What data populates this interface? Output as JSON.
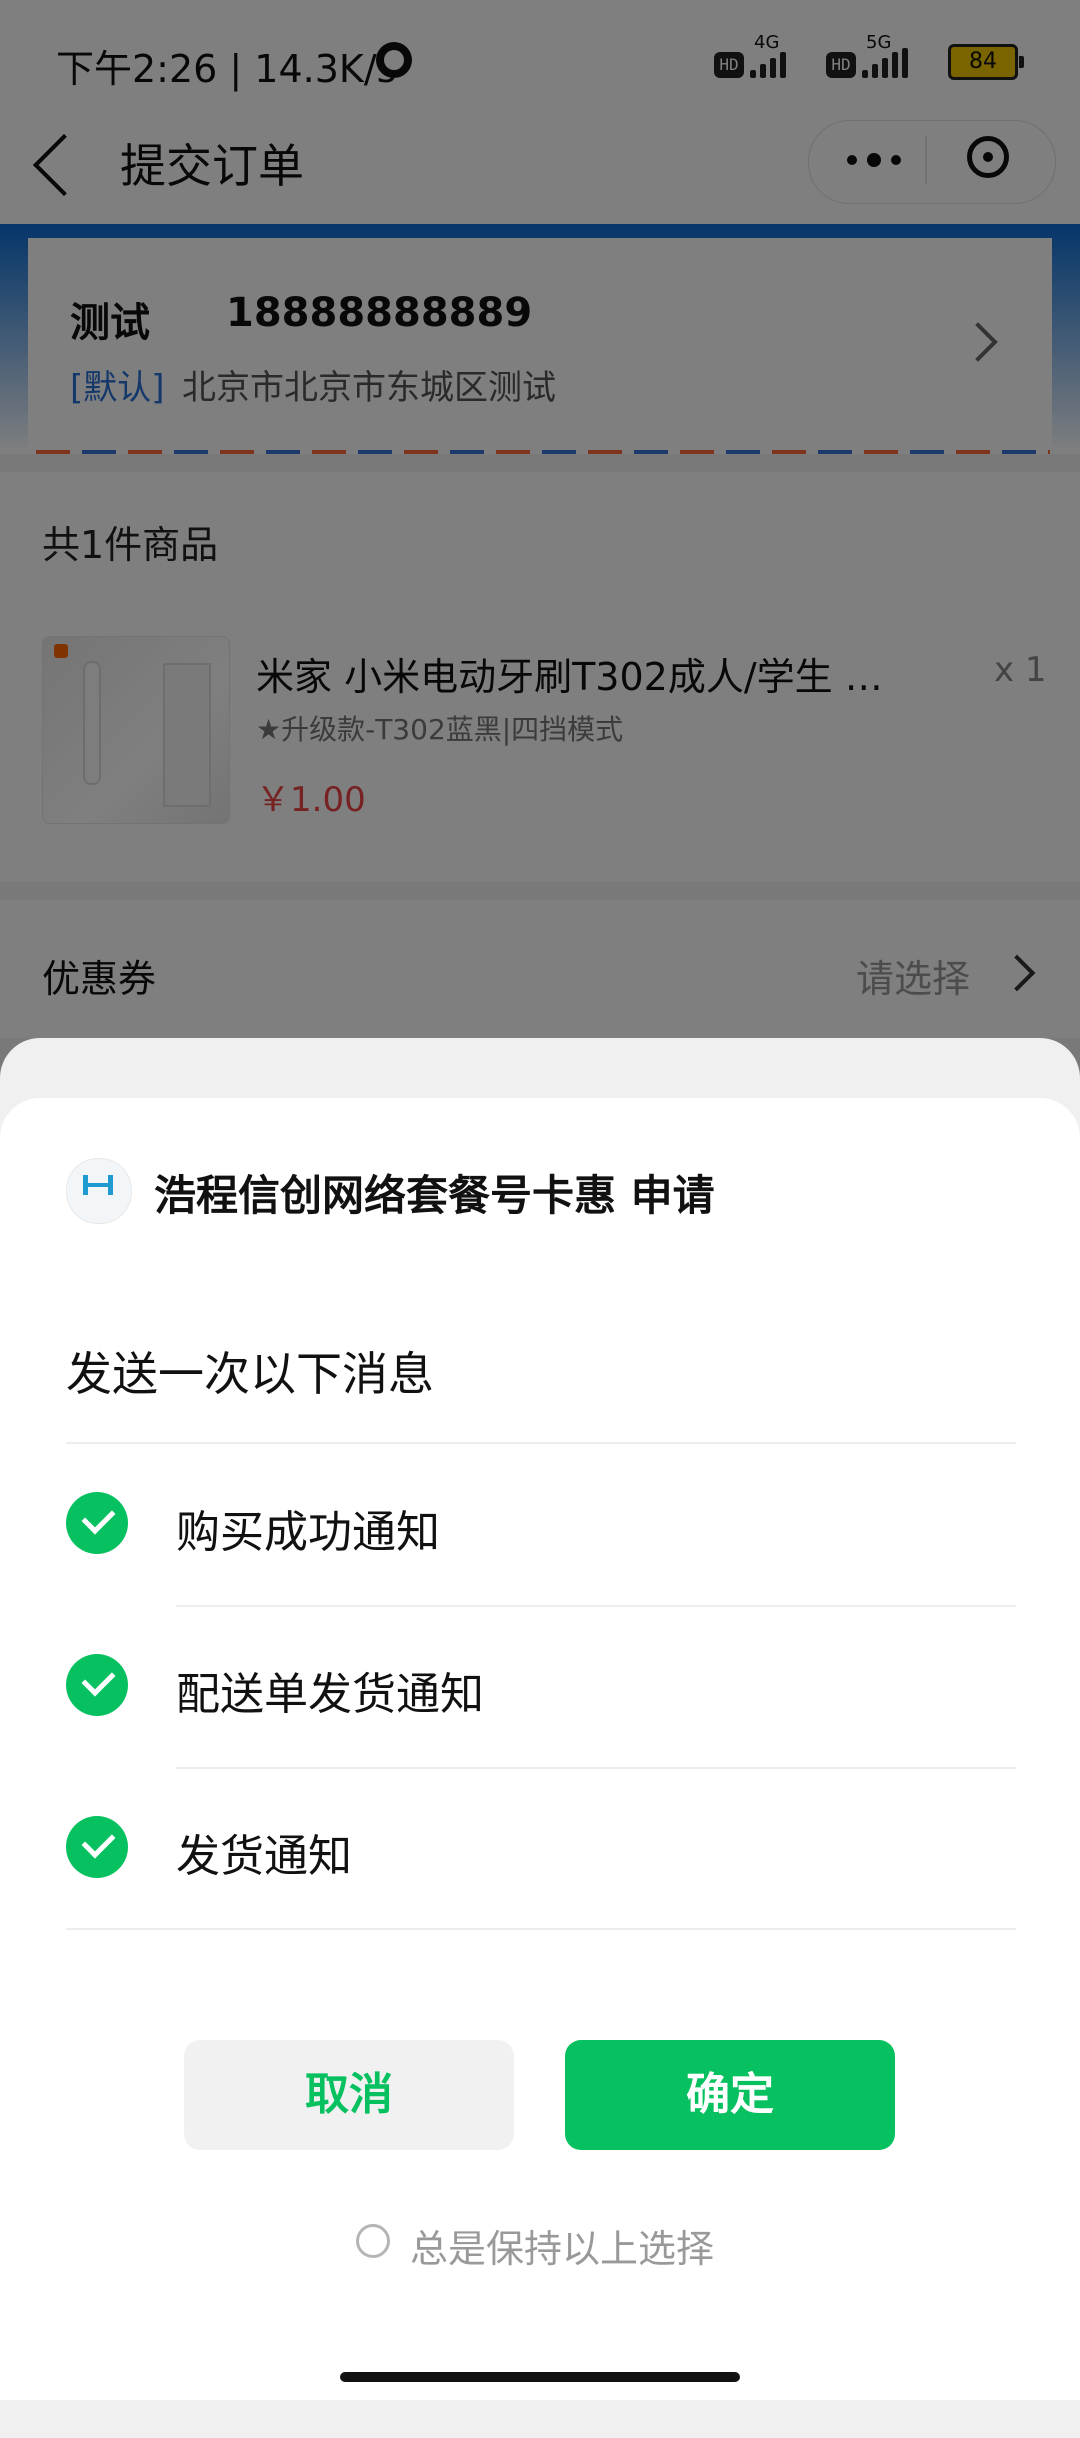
{
  "status_bar": {
    "time_speed": "下午2:26 | 14.3K/s",
    "hd_label": "HD",
    "net_4g": "4G",
    "net_5g": "5G",
    "battery": "84"
  },
  "navbar": {
    "title": "提交订单"
  },
  "address": {
    "name": "测试",
    "phone": "18888888889",
    "default_tag": "[默认]",
    "text": "北京市北京市东城区测试"
  },
  "goods": {
    "count_label": "共1件商品",
    "title": "米家 小米电动牙刷T302成人/学生 4…",
    "spec": "★升级款-T302蓝黑|四挡模式",
    "price": "￥1.00",
    "qty": "x 1"
  },
  "coupon": {
    "label": "优惠券",
    "value": "请选择"
  },
  "sheet": {
    "app_name": "浩程信创网络套餐号卡惠  申请",
    "send_title": "发送一次以下消息",
    "messages": [
      {
        "label": "购买成功通知"
      },
      {
        "label": "配送单发货通知"
      },
      {
        "label": "发货通知"
      }
    ],
    "cancel_label": "取消",
    "confirm_label": "确定",
    "keep_label": "总是保持以上选择"
  },
  "colors": {
    "accent": "#07c160",
    "price": "#e44444",
    "link": "#2a70d6"
  }
}
